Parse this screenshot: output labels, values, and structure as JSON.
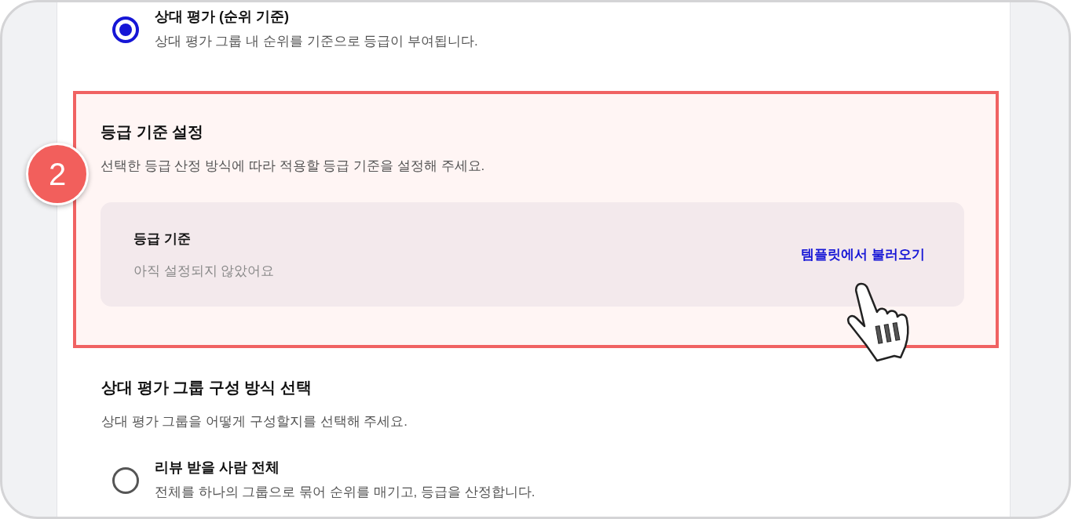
{
  "top_options": [
    {
      "title": "상대 평가 (순위 기준)",
      "description": "상대 평가 그룹 내 순위를 기준으로 등급이 부여됩니다.",
      "selected": true
    }
  ],
  "grade_section": {
    "badge": "2",
    "title": "등급 기준 설정",
    "description": "선택한 등급 산정 방식에 따라 적용할 등급 기준을 설정해 주세요.",
    "card": {
      "label": "등급 기준",
      "status": "아직 설정되지 않았어요",
      "action": "템플릿에서 불러오기"
    }
  },
  "group_section": {
    "title": "상대 평가 그룹 구성 방식 선택",
    "description": "상대 평가 그룹을 어떻게 구성할지를 선택해 주세요.",
    "options": [
      {
        "title": "리뷰 받을 사람 전체",
        "description": "전체를 하나의 그룹으로 묶어 순위를 매기고, 등급을 산정합니다.",
        "selected": false
      }
    ]
  }
}
